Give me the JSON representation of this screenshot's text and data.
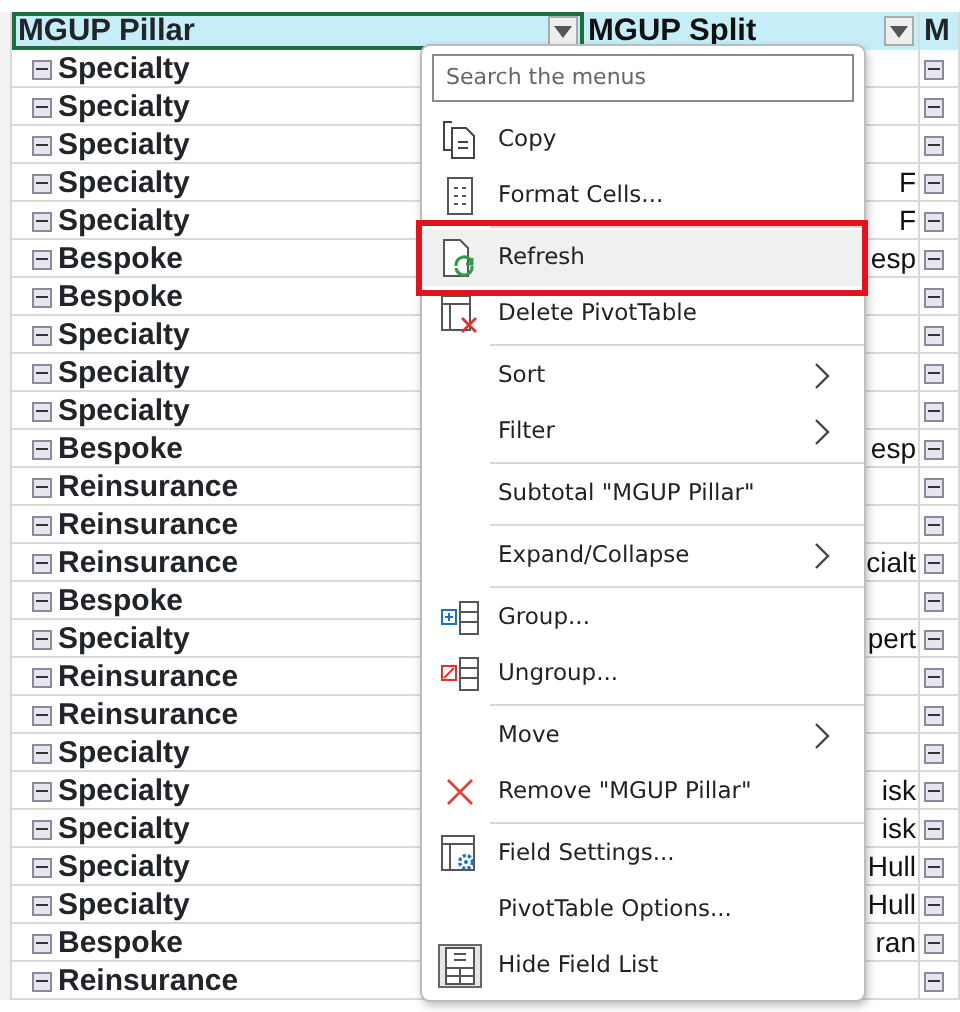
{
  "sheet": {
    "columns": [
      {
        "header": "MGUP Pillar",
        "filter": true,
        "selected": true
      },
      {
        "header": "MGUP Split",
        "filter": true,
        "selected": false
      },
      {
        "header": "M",
        "filter": false,
        "selected": false
      }
    ],
    "rows": [
      {
        "pillar": "Specialty"
      },
      {
        "pillar": "Specialty"
      },
      {
        "pillar": "Specialty"
      },
      {
        "pillar": "Specialty",
        "split": "F"
      },
      {
        "pillar": "Specialty",
        "split": "F"
      },
      {
        "pillar": "Bespoke",
        "split": "esp"
      },
      {
        "pillar": "Bespoke"
      },
      {
        "pillar": "Specialty"
      },
      {
        "pillar": "Specialty"
      },
      {
        "pillar": "Specialty"
      },
      {
        "pillar": "Bespoke",
        "split": "esp"
      },
      {
        "pillar": "Reinsurance"
      },
      {
        "pillar": "Reinsurance"
      },
      {
        "pillar": "Reinsurance",
        "split": "cialt"
      },
      {
        "pillar": "Bespoke"
      },
      {
        "pillar": "Specialty",
        "split": "pert"
      },
      {
        "pillar": "Reinsurance"
      },
      {
        "pillar": "Reinsurance"
      },
      {
        "pillar": "Specialty"
      },
      {
        "pillar": "Specialty",
        "split": "isk"
      },
      {
        "pillar": "Specialty",
        "split": "isk"
      },
      {
        "pillar": "Specialty",
        "split": "Hull"
      },
      {
        "pillar": "Specialty",
        "split": "Hull"
      },
      {
        "pillar": "Bespoke",
        "split": "ran"
      },
      {
        "pillar": "Reinsurance"
      }
    ]
  },
  "context_menu": {
    "search": {
      "placeholder": "Search the menus"
    },
    "groups": [
      [
        {
          "label": "Copy",
          "kind": "copy",
          "submenu": false,
          "highlighted": false
        },
        {
          "label": "Format Cells...",
          "kind": "format",
          "submenu": false,
          "highlighted": false
        }
      ],
      [
        {
          "label": "Refresh",
          "kind": "refresh",
          "submenu": false,
          "highlighted": true
        },
        {
          "label": "Delete PivotTable",
          "kind": "delete",
          "submenu": false,
          "highlighted": false
        }
      ],
      [
        {
          "label": "Sort",
          "kind": "plain",
          "submenu": true,
          "highlighted": false
        },
        {
          "label": "Filter",
          "kind": "plain",
          "submenu": true,
          "highlighted": false
        }
      ],
      [
        {
          "label": "Subtotal \"MGUP Pillar\"",
          "kind": "plain",
          "submenu": false,
          "highlighted": false
        }
      ],
      [
        {
          "label": "Expand/Collapse",
          "kind": "plain",
          "submenu": true,
          "highlighted": false
        }
      ],
      [
        {
          "label": "Group...",
          "kind": "group",
          "submenu": false,
          "highlighted": false
        },
        {
          "label": "Ungroup...",
          "kind": "ungroup",
          "submenu": false,
          "highlighted": false
        }
      ],
      [
        {
          "label": "Move",
          "kind": "plain",
          "submenu": true,
          "highlighted": false
        },
        {
          "label": "Remove \"MGUP Pillar\"",
          "kind": "remove",
          "submenu": false,
          "highlighted": false
        }
      ],
      [
        {
          "label": "Field Settings...",
          "kind": "settings",
          "submenu": false,
          "highlighted": false
        },
        {
          "label": "PivotTable Options...",
          "kind": "plain",
          "submenu": false,
          "highlighted": false
        },
        {
          "label": "Hide Field List",
          "kind": "fieldlist",
          "submenu": false,
          "highlighted": false
        }
      ]
    ]
  }
}
